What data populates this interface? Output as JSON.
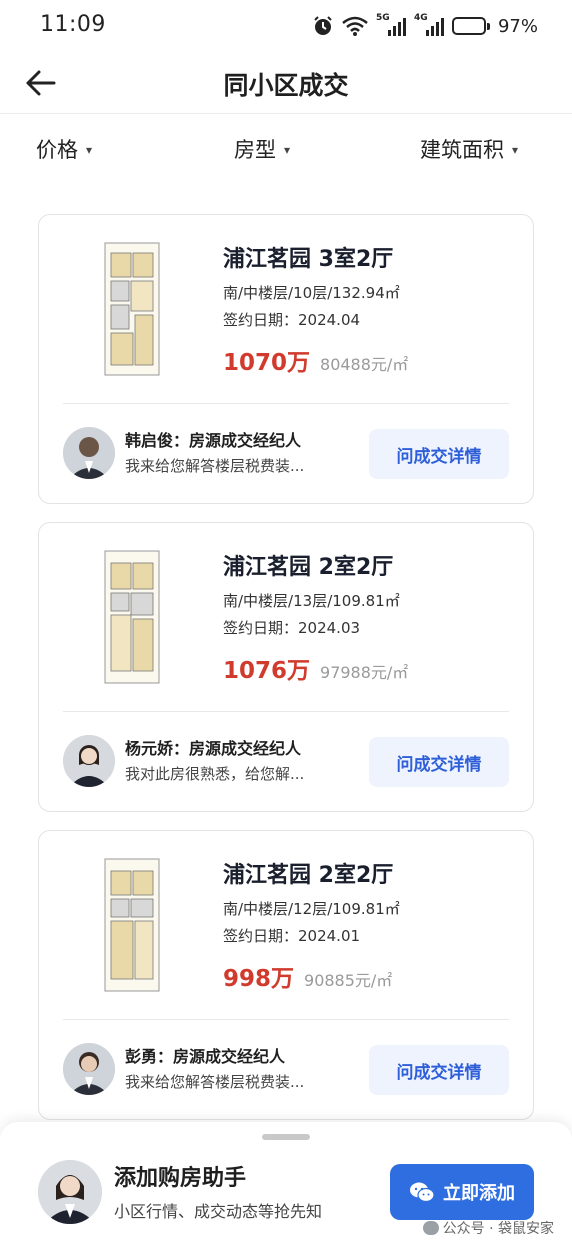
{
  "status": {
    "time": "11:09",
    "net1": "5G",
    "net2": "4G",
    "battery": "97%",
    "battery_level": 0.97
  },
  "header": {
    "title": "同小区成交",
    "back_icon": "arrow-left-icon"
  },
  "filters": [
    {
      "label": "价格"
    },
    {
      "label": "房型"
    },
    {
      "label": "建筑面积"
    }
  ],
  "listings": [
    {
      "name": "浦江茗园 3室2厅",
      "meta": "南/中楼层/10层/132.94㎡",
      "date": "签约日期：2024.04",
      "price": "1070万",
      "unit_price": "80488元/㎡",
      "agent": "韩启俊：房源成交经纪人",
      "message": "我来给您解答楼层税费装...",
      "button": "问成交详情"
    },
    {
      "name": "浦江茗园 2室2厅",
      "meta": "南/中楼层/13层/109.81㎡",
      "date": "签约日期：2024.03",
      "price": "1076万",
      "unit_price": "97988元/㎡",
      "agent": "杨元娇：房源成交经纪人",
      "message": "我对此房很熟悉，给您解...",
      "button": "问成交详情"
    },
    {
      "name": "浦江茗园 2室2厅",
      "meta": "南/中楼层/12层/109.81㎡",
      "date": "签约日期：2024.01",
      "price": "998万",
      "unit_price": "90885元/㎡",
      "agent": "彭勇：房源成交经纪人",
      "message": "我来给您解答楼层税费装...",
      "button": "问成交详情"
    }
  ],
  "assistant": {
    "title": "添加购房助手",
    "description": "小区行情、成交动态等抢先知",
    "button": "立即添加",
    "button_icon": "wechat-icon"
  },
  "watermark": "公众号 · 袋鼠安家",
  "colors": {
    "accent": "#2f6ee0",
    "price": "#d13b2d",
    "ask_bg": "#eef3fd"
  }
}
